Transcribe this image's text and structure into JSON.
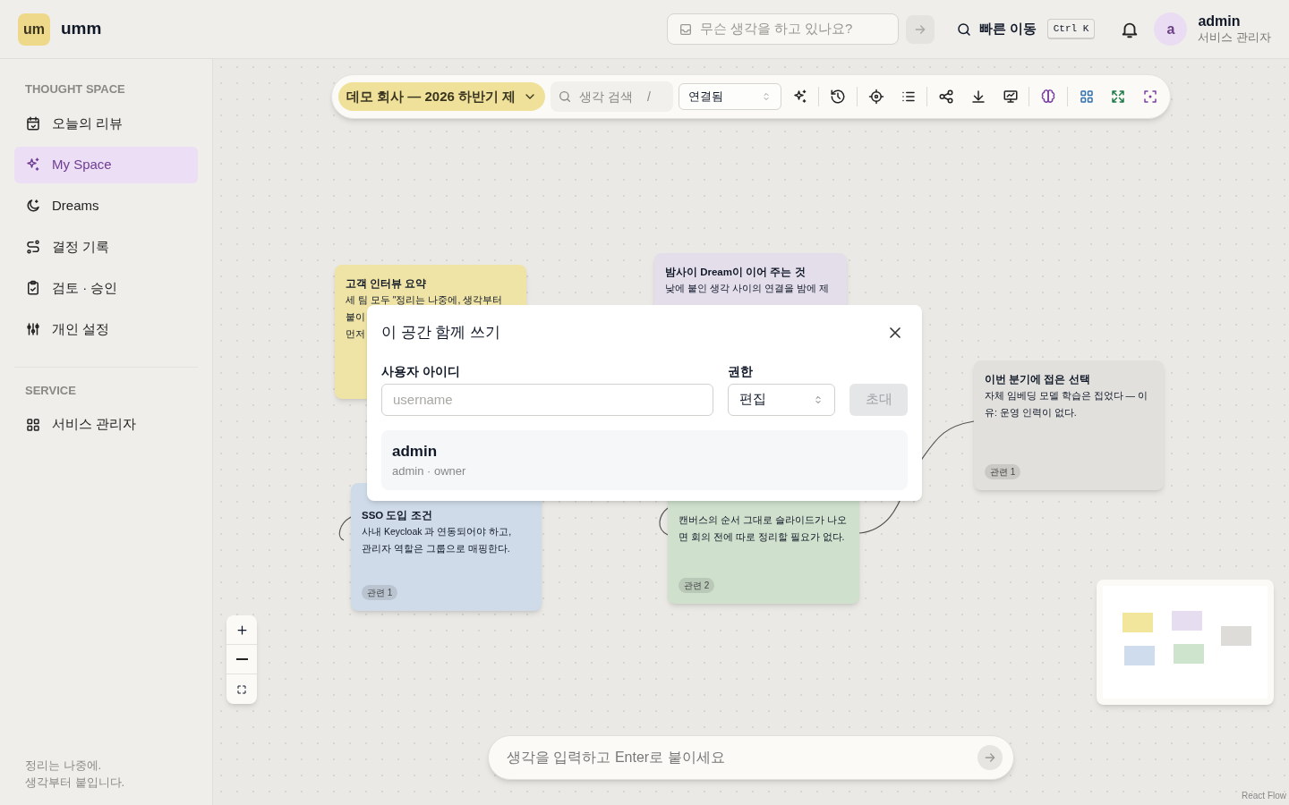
{
  "brand": {
    "logo": "um",
    "name": "umm"
  },
  "header": {
    "thought_placeholder": "무슨 생각을 하고 있나요?",
    "quick_jump": "빠른 이동",
    "shortcut": "Ctrl K",
    "avatar": "a",
    "user_name": "admin",
    "user_role": "서비스 관리자"
  },
  "sidebar": {
    "sections": [
      {
        "title": "THOUGHT SPACE",
        "items": [
          {
            "label": "오늘의 리뷰",
            "selected": false
          },
          {
            "label": "My Space",
            "selected": true
          },
          {
            "label": "Dreams",
            "selected": false
          },
          {
            "label": "결정 기록",
            "selected": false
          },
          {
            "label": "검토 · 승인",
            "selected": false
          },
          {
            "label": "개인 설정",
            "selected": false
          }
        ]
      },
      {
        "title": "SERVICE",
        "items": [
          {
            "label": "서비스 관리자",
            "selected": false
          }
        ]
      }
    ],
    "footer": "정리는 나중에.\n생각부터 붙입니다."
  },
  "toolbar": {
    "project": "데모 회사 — 2026 하반기 제",
    "search_placeholder": "생각 검색",
    "search_key": "/",
    "view": "연결됨"
  },
  "nodes": [
    {
      "color": "#efe3a5",
      "title": "고객 인터뷰 요약",
      "lines": [
        "세 팀 모두 \"정리는 나중에, 생각부터",
        "붙이",
        "먼저"
      ]
    },
    {
      "color": "#e4deeb",
      "title": "밤사이 Dream이 이어 주는 것",
      "lines": [
        "낮에 붙인 생각 사이의 연결을 밤에 제"
      ]
    },
    {
      "color": "#cfdbe8",
      "title": "SSO 도입 조건",
      "lines": [
        "사내 Keycloak 과 연동되어야 하고,",
        "관리자 역할은 그룹으로 매핑한다."
      ],
      "tag": "관련 1"
    },
    {
      "color": "#cfe0cc",
      "lines": [
        "캔버스의 순서 그대로 슬라이드가 나오",
        "면 회의 전에 따로 정리할 필요가 없다."
      ],
      "tag": "관련 2"
    },
    {
      "color": "#e1e0dc",
      "title": "이번 분기에 접은 선택",
      "lines": [
        "자체 임베딩 모델 학습은 접었다 — 이",
        "유: 운영 인력이 없다."
      ],
      "tag": "관련 1"
    }
  ],
  "composer": {
    "placeholder": "생각을 입력하고 Enter로 붙이세요"
  },
  "attribution": "React Flow",
  "dialog": {
    "title": "이 공간 함께 쓰기",
    "user_label": "사용자 아이디",
    "user_placeholder": "username",
    "role_label": "권한",
    "role_value": "편집",
    "invite": "초대",
    "invite_disabled": true,
    "members": [
      {
        "name": "admin",
        "detail": "admin · owner"
      }
    ]
  }
}
